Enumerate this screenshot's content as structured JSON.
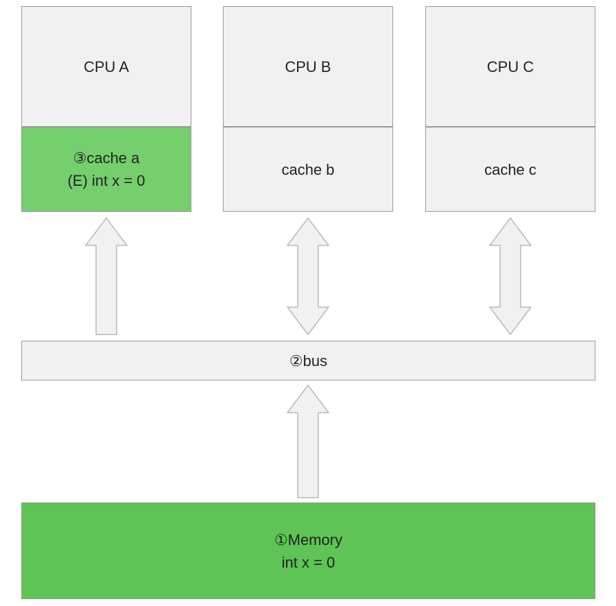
{
  "cpus": {
    "a": {
      "label": "CPU A"
    },
    "b": {
      "label": "CPU B"
    },
    "c": {
      "label": "CPU C"
    }
  },
  "caches": {
    "a": {
      "line1": "③cache a",
      "line2": "(E) int x = 0"
    },
    "b": {
      "line1": "cache b"
    },
    "c": {
      "line1": "cache c"
    }
  },
  "bus": {
    "label": "②bus"
  },
  "memory": {
    "line1": "①Memory",
    "line2": "int x = 0"
  }
}
